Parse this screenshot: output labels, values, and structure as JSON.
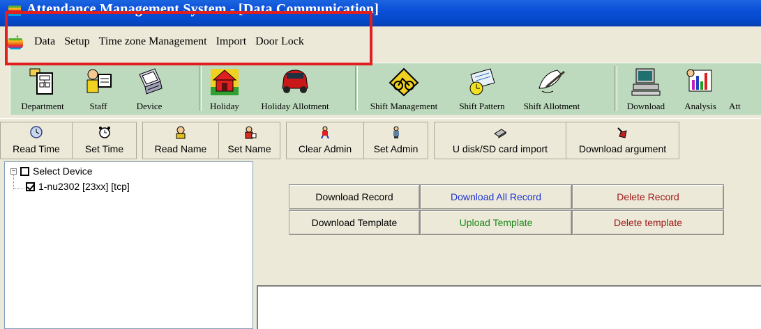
{
  "window": {
    "title": "Attendance Management System - [Data Communication]"
  },
  "menu": {
    "items": [
      "Data",
      "Setup",
      "Time zone Management",
      "Import",
      "Door Lock"
    ]
  },
  "toolbar_main": {
    "buttons": [
      {
        "label": "Department",
        "icon": "department-icon"
      },
      {
        "label": "Staff",
        "icon": "staff-icon"
      },
      {
        "label": "Device",
        "icon": "device-icon"
      },
      {
        "label": "Holiday",
        "icon": "holiday-icon"
      },
      {
        "label": "Holiday Allotment",
        "icon": "car-icon"
      },
      {
        "label": "Shift Management",
        "icon": "bicycle-sign-icon"
      },
      {
        "label": "Shift Pattern",
        "icon": "calendar-clock-icon"
      },
      {
        "label": "Shift Allotment",
        "icon": "pen-icon"
      },
      {
        "label": "Download",
        "icon": "computer-icon"
      },
      {
        "label": "Analysis",
        "icon": "chart-icon"
      },
      {
        "label": "Att",
        "icon": "attendance-icon"
      }
    ]
  },
  "toolbar_device": {
    "buttons": [
      {
        "label": "Read Time",
        "icon": "clock-icon"
      },
      {
        "label": "Set Time",
        "icon": "alarm-clock-icon"
      },
      {
        "label": "Read Name",
        "icon": "person-read-icon"
      },
      {
        "label": "Set Name",
        "icon": "person-set-icon"
      },
      {
        "label": "Clear Admin",
        "icon": "admin-clear-icon"
      },
      {
        "label": "Set Admin",
        "icon": "admin-set-icon"
      },
      {
        "label": "U disk/SD card import",
        "icon": "usb-disk-icon"
      },
      {
        "label": "Download argument",
        "icon": "download-arg-icon"
      }
    ]
  },
  "device_tree": {
    "root_label": "Select Device",
    "device_label": "1-nu2302  [23xx]  [tcp]"
  },
  "download_panel": {
    "download_record": "Download Record",
    "download_all_record": "Download All Record",
    "delete_record": "Delete Record",
    "download_template": "Download Template",
    "upload_template": "Upload Template",
    "delete_template": "Delete template"
  },
  "colors": {
    "blue_text": "#1a32d0",
    "green_text": "#1a8a1a",
    "red_text": "#a01818",
    "highlight": "#e02020"
  }
}
